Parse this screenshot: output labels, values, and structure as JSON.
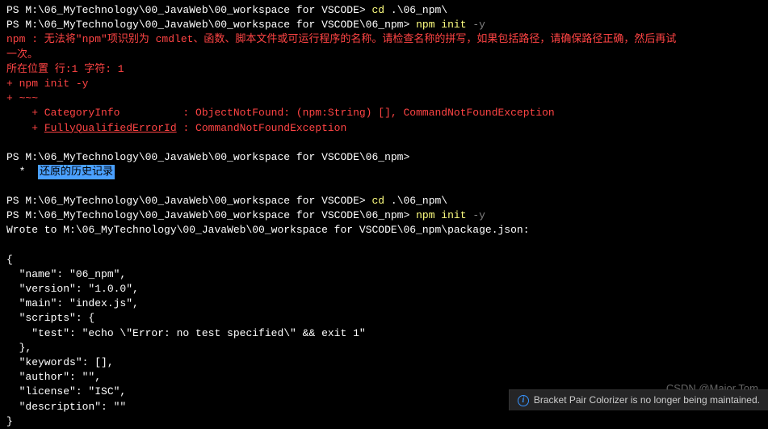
{
  "lines": {
    "p1_prefix": "PS M:\\06_MyTechnology\\00_JavaWeb\\00_workspace for VSCODE> ",
    "p1_cmd": "cd ",
    "p1_arg": ".\\06_npm\\",
    "p2_prefix": "PS M:\\06_MyTechnology\\00_JavaWeb\\00_workspace for VSCODE\\06_npm> ",
    "p2_cmd": "npm init ",
    "p2_arg": "-y",
    "err1": "npm : 无法将\"npm\"项识别为 cmdlet、函数、脚本文件或可运行程序的名称。请检查名称的拼写，如果包括路径，请确保路径正确，然后再试",
    "err2": "一次。",
    "err3": "所在位置 行:1 字符: 1",
    "err4": "+ npm init -y",
    "err5": "+ ~~~",
    "cat_label": "    + CategoryInfo          : ",
    "cat_val": "ObjectNotFound: (npm:String) [], CommandNotFoundException",
    "fq_label": "    + ",
    "fq_ul": "FullyQualifiedErrorId",
    "fq_sep": " : ",
    "fq_val": "CommandNotFoundException",
    "p3": "PS M:\\06_MyTechnology\\00_JavaWeb\\00_workspace for VSCODE\\06_npm>",
    "star": "  *  ",
    "highlight": "还原的历史记录",
    "p4_prefix": "PS M:\\06_MyTechnology\\00_JavaWeb\\00_workspace for VSCODE> ",
    "p4_cmd": "cd ",
    "p4_arg": ".\\06_npm\\",
    "p5_prefix": "PS M:\\06_MyTechnology\\00_JavaWeb\\00_workspace for VSCODE\\06_npm> ",
    "p5_cmd": "npm init ",
    "p5_arg": "-y",
    "wrote": "Wrote to M:\\06_MyTechnology\\00_JavaWeb\\00_workspace for VSCODE\\06_npm\\package.json:",
    "j1": "{",
    "j2": "  \"name\": \"06_npm\",",
    "j3": "  \"version\": \"1.0.0\",",
    "j4": "  \"main\": \"index.js\",",
    "j5": "  \"scripts\": {",
    "j6": "    \"test\": \"echo \\\"Error: no test specified\\\" && exit 1\"",
    "j7": "  },",
    "j8": "  \"keywords\": [],",
    "j9": "  \"author\": \"\",",
    "j10": "  \"license\": \"ISC\",",
    "j11": "  \"description\": \"\"",
    "j12": "}"
  },
  "watermark": "CSDN @Major Tom",
  "notification": "Bracket Pair Colorizer is no longer being maintained."
}
